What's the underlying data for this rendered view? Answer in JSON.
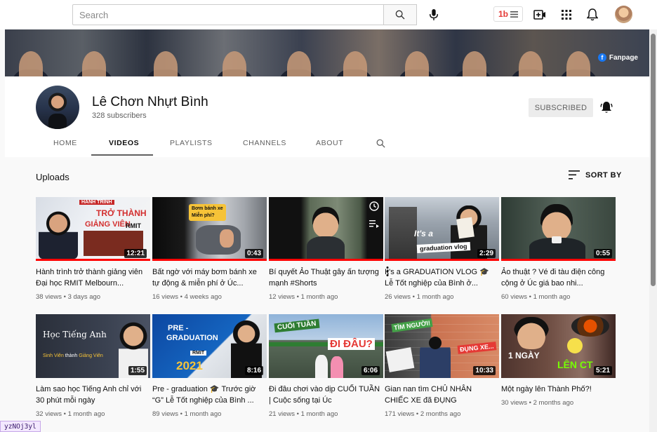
{
  "search": {
    "placeholder": "Search"
  },
  "header": {
    "extension_label": "1b",
    "fanpage_label": "Fanpage",
    "fb_glyph": "f"
  },
  "channel": {
    "name": "Lê Chơn Nhựt Bình",
    "subscribers": "328 subscribers",
    "subscribe_label": "SUBSCRIBED"
  },
  "tabs": [
    {
      "label": "HOME",
      "active": false
    },
    {
      "label": "VIDEOS",
      "active": true
    },
    {
      "label": "PLAYLISTS",
      "active": false
    },
    {
      "label": "CHANNELS",
      "active": false
    },
    {
      "label": "ABOUT",
      "active": false
    }
  ],
  "section": {
    "title": "Uploads",
    "sort_label": "SORT BY"
  },
  "videos": [
    {
      "title": "Hành trình trở thành giảng viên Đại học RMIT Melbourn...",
      "views": "38 views",
      "age": "3 days ago",
      "duration": "12:21",
      "watched": 1.0,
      "overlay": [
        "HÀNH TRÌNH",
        "TRỞ THÀNH",
        "GIẢNG VIÊN",
        "RMIT"
      ]
    },
    {
      "title": "Bất ngờ với máy bơm bánh xe tự động & miễn phí ở Úc...",
      "views": "16 views",
      "age": "4 weeks ago",
      "duration": "0:43",
      "watched": 1.0,
      "overlay": [
        "Bơm bánh xe",
        "Miễn phí?"
      ]
    },
    {
      "title": "Bí quyết Ảo Thuật gây ấn tượng mạnh #Shorts",
      "views": "12 views",
      "age": "1 month ago",
      "duration": "",
      "watched": 1.0,
      "overlay": []
    },
    {
      "title": "It's a GRADUATION VLOG 🎓 Lễ Tốt nghiệp của Bình ở...",
      "views": "26 views",
      "age": "1 month ago",
      "duration": "2:29",
      "watched": 1.0,
      "overlay": [
        "It's a",
        "graduation vlog"
      ]
    },
    {
      "title": "Ảo thuật ? Vé đi tàu điện công cộng ở Úc giá bao nhi...",
      "views": "60 views",
      "age": "1 month ago",
      "duration": "0:55",
      "watched": 1.0,
      "overlay": []
    },
    {
      "title": "Làm sao học Tiếng Anh chỉ với 30 phút mỗi ngày",
      "views": "32 views",
      "age": "1 month ago",
      "duration": "1:55",
      "watched": 0,
      "overlay": [
        "Học Tiếng Anh",
        "Sinh Viên",
        "thành",
        "Giảng Viên"
      ]
    },
    {
      "title": "Pre - graduation 🎓 Trước giờ “G” Lễ Tốt nghiệp của Bình ...",
      "views": "89 views",
      "age": "1 month ago",
      "duration": "8:16",
      "watched": 0,
      "overlay": [
        "PRE -",
        "GRADUATION",
        "RMIT",
        "2021"
      ]
    },
    {
      "title": "Đi đâu chơi vào dịp CUỐI TUẦN | Cuộc sống tại Úc",
      "views": "21 views",
      "age": "1 month ago",
      "duration": "6:06",
      "watched": 0,
      "overlay": [
        "CUỐI TUẦN",
        "ĐI ĐÂU?"
      ]
    },
    {
      "title": "Gian nan tìm CHỦ NHÂN CHIẾC XE đã ĐỤNG",
      "views": "171 views",
      "age": "2 months ago",
      "duration": "10:33",
      "watched": 0,
      "overlay": [
        "TÌM NGƯỜI!",
        "ĐỤNG XE..."
      ]
    },
    {
      "title": "Một ngày lên Thành Phố?!",
      "views": "30 views",
      "age": "2 months ago",
      "duration": "5:21",
      "watched": 0,
      "overlay": [
        "1 NGÀY",
        "LÊN CT"
      ]
    }
  ],
  "status_tag": "yzNOj3yl",
  "colors": {
    "accent_red": "#ff0000",
    "fb_blue": "#1877f2",
    "ext_red": "#e53935"
  }
}
